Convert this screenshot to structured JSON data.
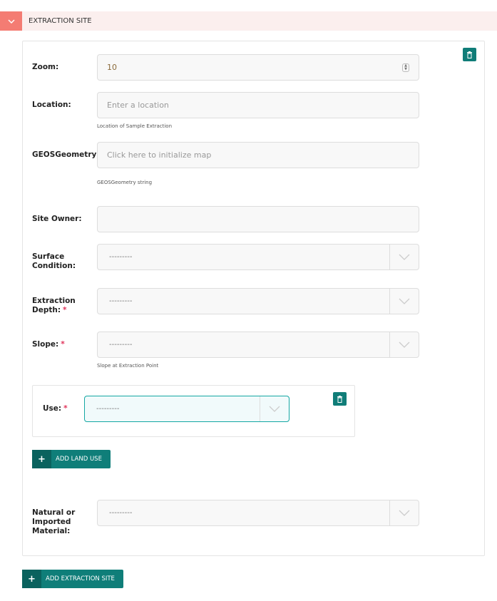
{
  "section": {
    "title": "EXTRACTION SITE"
  },
  "fields": {
    "zoom": {
      "label": "Zoom:",
      "value": "10"
    },
    "location": {
      "label": "Location:",
      "placeholder": "Enter a location",
      "help": "Location of Sample Extraction"
    },
    "geos": {
      "label": "GEOSGeometry:",
      "placeholder": "Click here to initialize map",
      "help": "GEOSGeometry string"
    },
    "site_owner": {
      "label": "Site Owner:",
      "value": ""
    },
    "surface": {
      "label": "Surface Condition:",
      "value": "---------"
    },
    "depth": {
      "label": "Extraction Depth:",
      "value": "---------"
    },
    "slope": {
      "label": "Slope:",
      "value": "---------",
      "help": "Slope at Extraction Point"
    },
    "use": {
      "label": "Use:",
      "value": "---------"
    },
    "natural": {
      "label": "Natural or Imported Material:",
      "value": "---------"
    }
  },
  "buttons": {
    "add_land_use": "ADD LAND USE",
    "add_extraction_site": "ADD EXTRACTION SITE",
    "plus": "+"
  },
  "required_mark": "*",
  "colors": {
    "accent": "#0f7e79",
    "header_toggle": "#f47c73",
    "header_bg": "#fbefee"
  }
}
